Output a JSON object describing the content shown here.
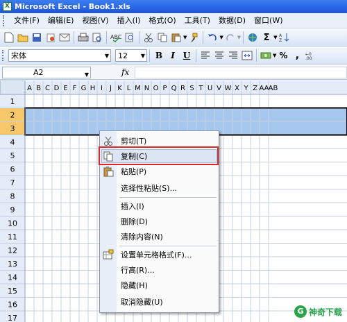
{
  "window": {
    "title": "Microsoft Excel - Book1.xls",
    "logo_text": "X"
  },
  "menu": {
    "items": [
      "文件(F)",
      "编辑(E)",
      "视图(V)",
      "插入(I)",
      "格式(O)",
      "工具(T)",
      "数据(D)",
      "窗口(W)"
    ]
  },
  "format_toolbar": {
    "font": "宋体",
    "size": "12",
    "bold": "B",
    "italic": "I",
    "underline": "U",
    "percent": "%",
    "comma": ","
  },
  "formula_bar": {
    "name_box": "A2",
    "fx": "fx",
    "value": ""
  },
  "grid": {
    "columns": [
      "A",
      "B",
      "C",
      "D",
      "E",
      "F",
      "G",
      "H",
      "I",
      "J",
      "K",
      "L",
      "M",
      "N",
      "O",
      "P",
      "Q",
      "R",
      "S",
      "T",
      "U",
      "V",
      "W",
      "X",
      "Y",
      "Z",
      "AA",
      "AB"
    ],
    "rows": [
      "1",
      "2",
      "3",
      "4",
      "5",
      "6",
      "7",
      "8",
      "9",
      "10",
      "11",
      "12",
      "13",
      "14",
      "15",
      "16",
      "17"
    ],
    "selected_rows": [
      "2",
      "3"
    ],
    "selection_color": "#a6c8ee"
  },
  "context_menu": {
    "items": [
      {
        "label": "剪切(T)",
        "icon": "scissors-icon"
      },
      {
        "label": "复制(C)",
        "icon": "copy-icon",
        "highlighted": true
      },
      {
        "label": "粘贴(P)",
        "icon": "paste-icon"
      },
      {
        "label": "选择性粘贴(S)...",
        "icon": ""
      },
      {
        "label": "插入(I)",
        "icon": ""
      },
      {
        "label": "删除(D)",
        "icon": ""
      },
      {
        "label": "清除内容(N)",
        "icon": ""
      },
      {
        "label": "设置单元格格式(F)...",
        "icon": "format-cells-icon"
      },
      {
        "label": "行高(R)...",
        "icon": ""
      },
      {
        "label": "隐藏(H)",
        "icon": ""
      },
      {
        "label": "取消隐藏(U)",
        "icon": ""
      }
    ],
    "highlight_border_color": "#d9262a"
  },
  "watermark": {
    "logo": "G",
    "text": "神奇下载"
  }
}
